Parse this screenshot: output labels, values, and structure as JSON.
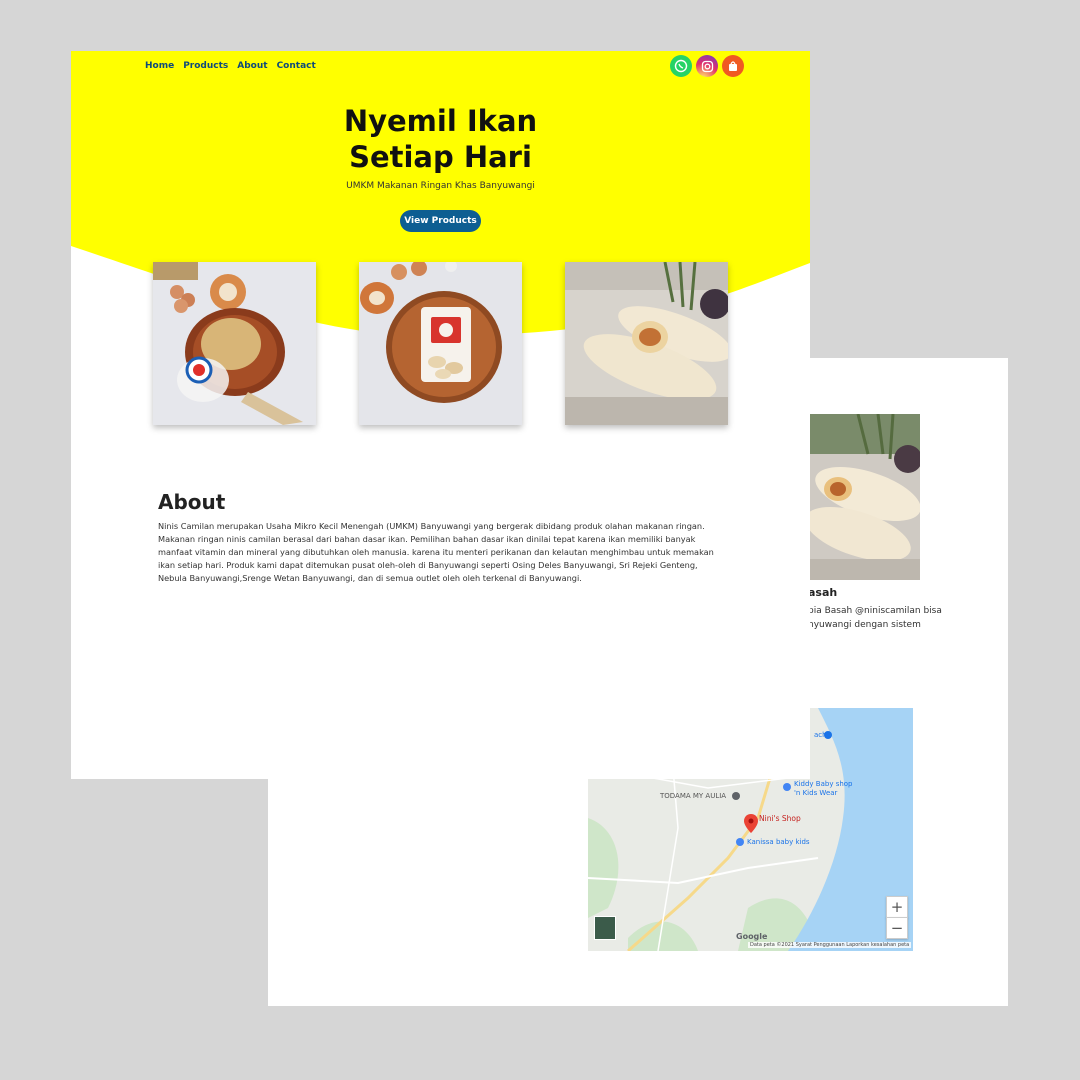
{
  "nav": {
    "links": [
      "Home",
      "Products",
      "About",
      "Contact"
    ]
  },
  "socials": [
    "whatsapp-icon",
    "instagram-icon",
    "shop-icon"
  ],
  "hero": {
    "title_line1": "Nyemil Ikan",
    "title_line2": "Setiap Hari",
    "subtitle": "UMKM Makanan Ringan Khas Banyuwangi",
    "cta_label": "View Products"
  },
  "products": [
    {
      "name": "teri-product"
    },
    {
      "name": "fish-cracker-product"
    },
    {
      "name": "crepe-roll-product"
    }
  ],
  "about": {
    "title": "About",
    "text": "Ninis Camilan merupakan Usaha Mikro Kecil Menengah (UMKM) Banyuwangi yang bergerak dibidang produk olahan makanan ringan. Makanan ringan ninis camilan berasal dari bahan dasar ikan. Pemilihan bahan dasar ikan dinilai tepat karena ikan memiliki banyak manfaat vitamin dan mineral yang dibutuhkan oleh manusia. karena itu menteri perikanan dan kelautan menghimbau untuk memakan ikan setiap hari. Produk kami dapat ditemukan pusat oleh-oleh di Banyuwangi seperti Osing Deles Banyuwangi, Sri Rejeki Genteng, Nebula Banyuwangi,Srenge Wetan Banyuwangi, dan di semua outlet oleh oleh terkenal di Banyuwangi."
  },
  "back_page": {
    "product_title": "asah",
    "product_desc_line1": "pia Basah @niniscamilan bisa",
    "product_desc_line2": "nyuwangi dengan sistem"
  },
  "map": {
    "pin_label": "Nini's Shop",
    "poi": [
      "TODAMA MY AULIA",
      "Kiddy Baby shop",
      "'n Kids Wear",
      "Kanissa baby kids",
      "ach"
    ],
    "zoom_in": "+",
    "zoom_out": "−",
    "google": "Google",
    "footer": "Data peta ©2021   Syarat Penggunaan   Laporkan kesalahan peta"
  },
  "colors": {
    "hero_yellow": "#ffff00",
    "cta_blue": "#0d5e92",
    "nav_blue": "#0e4a7a",
    "sea": "#a6d3f5"
  }
}
